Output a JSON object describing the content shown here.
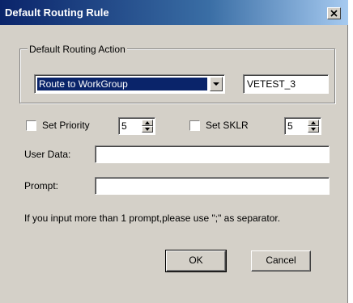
{
  "window": {
    "title": "Default Routing Rule"
  },
  "routing_action": {
    "group_label": "Default Routing Action",
    "selected_action": "Route to WorkGroup",
    "workgroup_value": "VETEST_3"
  },
  "priority": {
    "label": "Set Priority",
    "value": "5",
    "checked": false
  },
  "sklr": {
    "label": "Set SKLR",
    "value": "5",
    "checked": false
  },
  "user_data": {
    "label": "User Data:",
    "value": ""
  },
  "prompt": {
    "label": "Prompt:",
    "value": ""
  },
  "hint_text": "If you input more than 1 prompt,please use \";\" as separator.",
  "buttons": {
    "ok": "OK",
    "cancel": "Cancel"
  }
}
